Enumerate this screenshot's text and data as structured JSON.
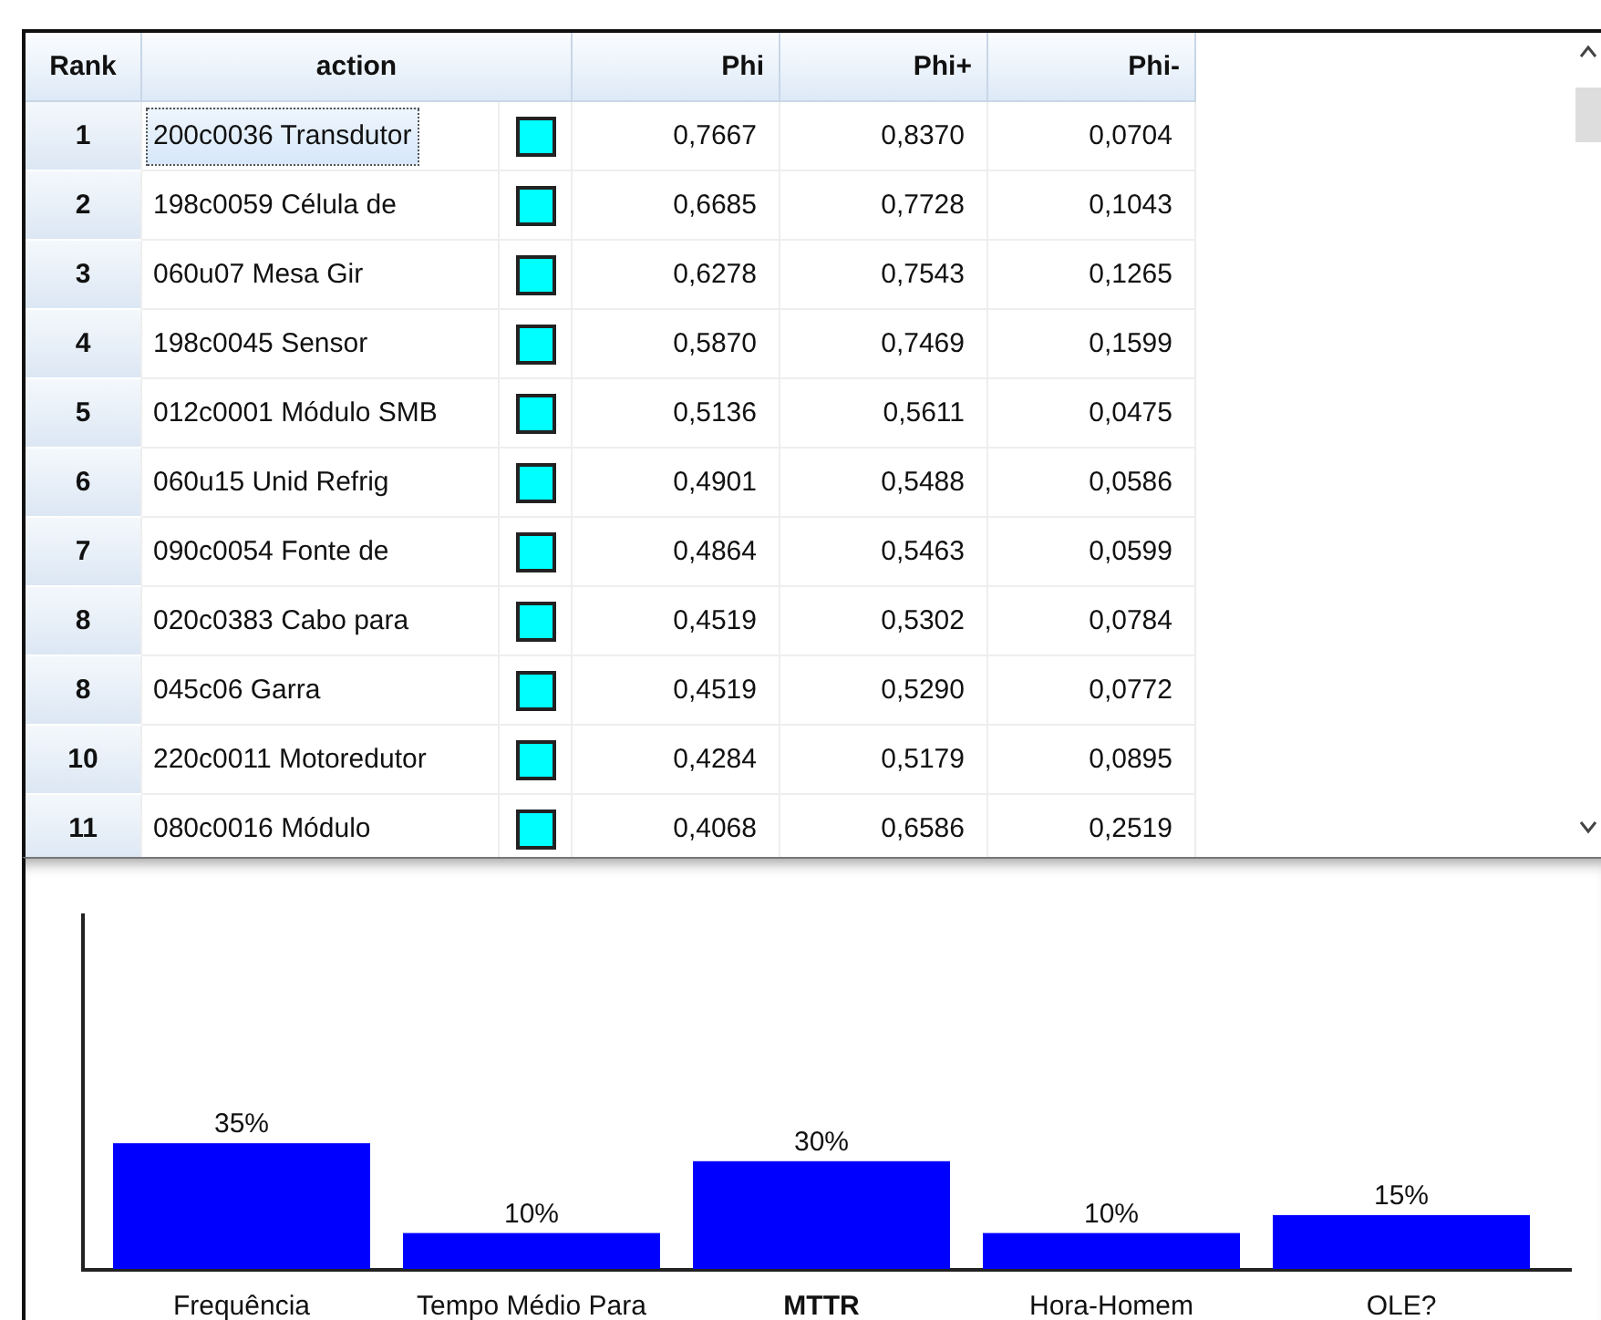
{
  "table": {
    "columns": [
      "Rank",
      "action",
      "Phi",
      "Phi+",
      "Phi-"
    ],
    "rows": [
      {
        "rank": "1",
        "action": "200c0036 Transdutor",
        "color": "#00ffff",
        "phi": "0,7667",
        "phi_plus": "0,8370",
        "phi_minus": "0,0704",
        "selected": true
      },
      {
        "rank": "2",
        "action": "198c0059 Célula de",
        "color": "#00ffff",
        "phi": "0,6685",
        "phi_plus": "0,7728",
        "phi_minus": "0,1043",
        "selected": false
      },
      {
        "rank": "3",
        "action": "060u07 Mesa Gir",
        "color": "#00ffff",
        "phi": "0,6278",
        "phi_plus": "0,7543",
        "phi_minus": "0,1265",
        "selected": false
      },
      {
        "rank": "4",
        "action": "198c0045 Sensor",
        "color": "#00ffff",
        "phi": "0,5870",
        "phi_plus": "0,7469",
        "phi_minus": "0,1599",
        "selected": false
      },
      {
        "rank": "5",
        "action": "012c0001 Módulo SMB",
        "color": "#00ffff",
        "phi": "0,5136",
        "phi_plus": "0,5611",
        "phi_minus": "0,0475",
        "selected": false
      },
      {
        "rank": "6",
        "action": "060u15 Unid Refrig",
        "color": "#00ffff",
        "phi": "0,4901",
        "phi_plus": "0,5488",
        "phi_minus": "0,0586",
        "selected": false
      },
      {
        "rank": "7",
        "action": "090c0054 Fonte de",
        "color": "#00ffff",
        "phi": "0,4864",
        "phi_plus": "0,5463",
        "phi_minus": "0,0599",
        "selected": false
      },
      {
        "rank": "8",
        "action": "020c0383 Cabo para",
        "color": "#00ffff",
        "phi": "0,4519",
        "phi_plus": "0,5302",
        "phi_minus": "0,0784",
        "selected": false
      },
      {
        "rank": "8",
        "action": "045c06 Garra",
        "color": "#00ffff",
        "phi": "0,4519",
        "phi_plus": "0,5290",
        "phi_minus": "0,0772",
        "selected": false
      },
      {
        "rank": "10",
        "action": "220c0011 Motoredutor",
        "color": "#00ffff",
        "phi": "0,4284",
        "phi_plus": "0,5179",
        "phi_minus": "0,0895",
        "selected": false
      },
      {
        "rank": "11",
        "action": "080c0016 Módulo",
        "color": "#00ffff",
        "phi": "0,4068",
        "phi_plus": "0,6586",
        "phi_minus": "0,2519",
        "selected": false
      }
    ]
  },
  "chart": {
    "chart_data": {
      "type": "bar",
      "categories": [
        "Frequência",
        "Tempo Médio Para",
        "MTTR",
        "Hora-Homem",
        "OLE?"
      ],
      "values": [
        35,
        10,
        30,
        10,
        15
      ],
      "ylim": [
        0,
        100
      ],
      "data_labels": true,
      "value_labels": [
        "35%",
        "10%",
        "30%",
        "10%",
        "15%"
      ]
    },
    "bold_categories": [
      false,
      false,
      true,
      false,
      false
    ]
  }
}
